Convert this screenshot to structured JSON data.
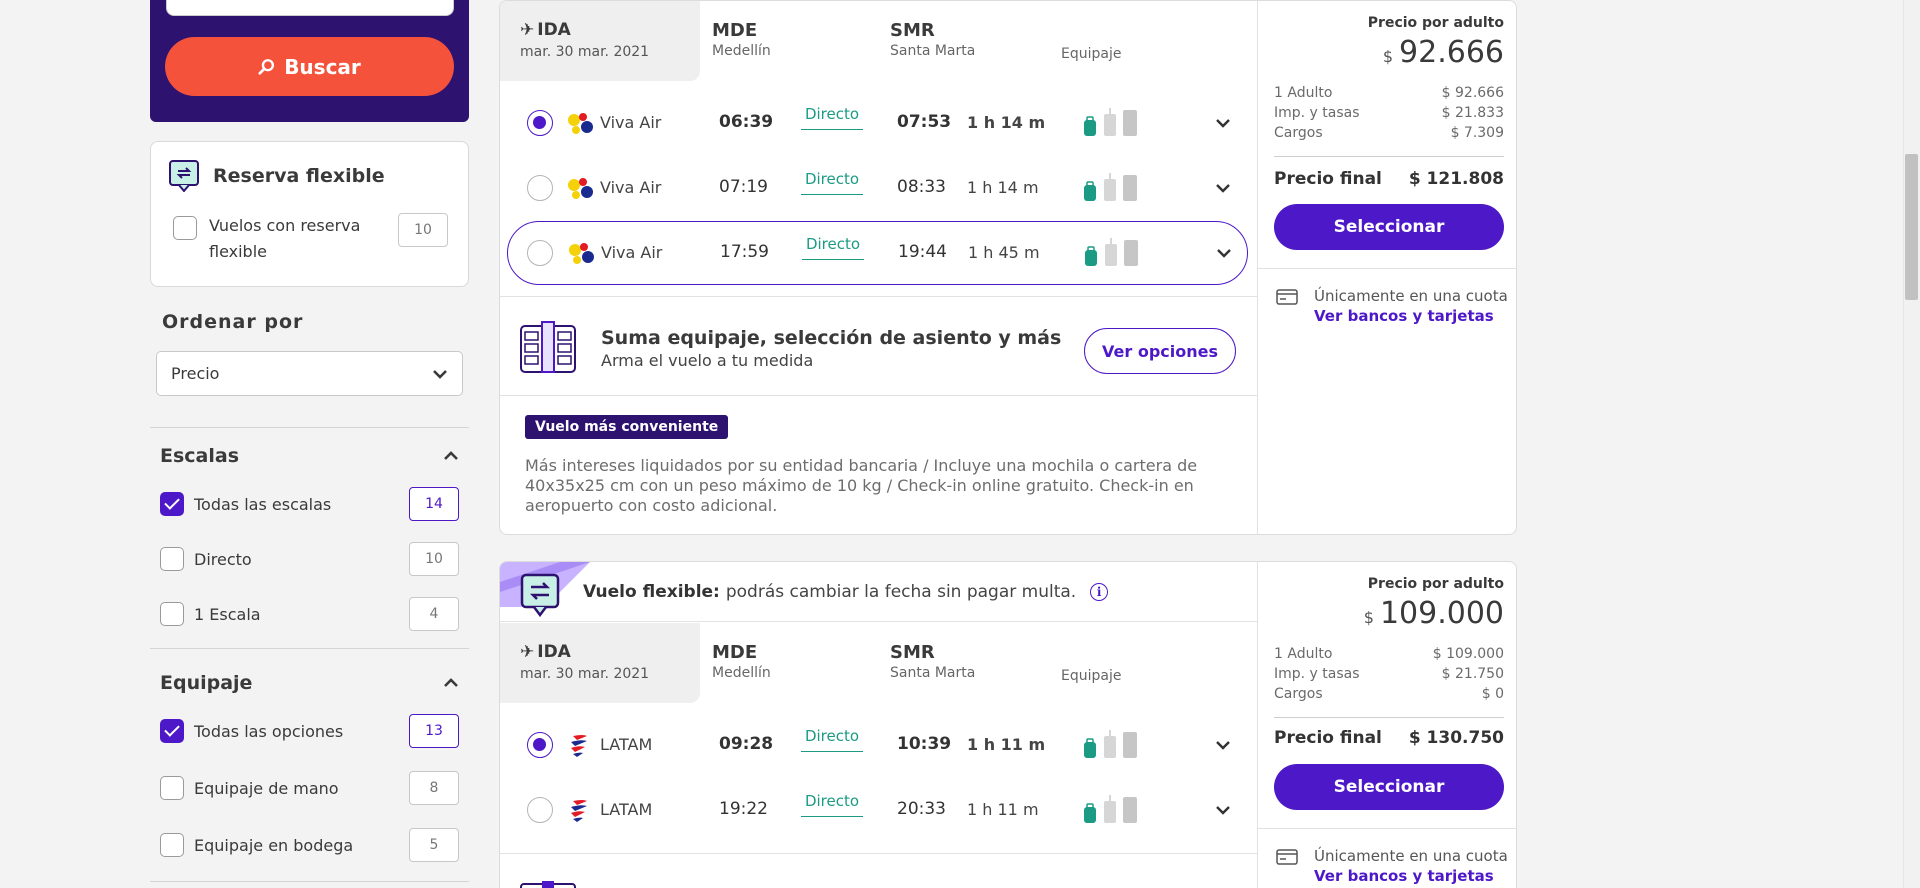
{
  "search": {
    "button_label": "Buscar"
  },
  "flexible_filter": {
    "title": "Reserva flexible",
    "option_label": "Vuelos con reserva flexible",
    "count": "10"
  },
  "sort": {
    "title": "Ordenar por",
    "selected": "Precio"
  },
  "filters": {
    "stops": {
      "title": "Escalas",
      "options": [
        {
          "label": "Todas las escalas",
          "count": "14",
          "checked": true
        },
        {
          "label": "Directo",
          "count": "10",
          "checked": false
        },
        {
          "label": "1 Escala",
          "count": "4",
          "checked": false
        }
      ]
    },
    "baggage": {
      "title": "Equipaje",
      "options": [
        {
          "label": "Todas las opciones",
          "count": "13",
          "checked": true
        },
        {
          "label": "Equipaje de mano",
          "count": "8",
          "checked": false
        },
        {
          "label": "Equipaje en bodega",
          "count": "5",
          "checked": false
        }
      ]
    }
  },
  "card1": {
    "direction": "IDA",
    "date": "mar. 30 mar. 2021",
    "origin": {
      "code": "MDE",
      "city": "Medellín"
    },
    "destination": {
      "code": "SMR",
      "city": "Santa Marta"
    },
    "baggage_header": "Equipaje",
    "flights": [
      {
        "airline": "Viva Air",
        "dep": "06:39",
        "type": "Directo",
        "arr": "07:53",
        "duration": "1 h 14 m"
      },
      {
        "airline": "Viva Air",
        "dep": "07:19",
        "type": "Directo",
        "arr": "08:33",
        "duration": "1 h 14 m"
      },
      {
        "airline": "Viva Air",
        "dep": "17:59",
        "type": "Directo",
        "arr": "19:44",
        "duration": "1 h 45 m"
      }
    ],
    "extras": {
      "title": "Suma equipaje, selección de asiento y más",
      "subtitle": "Arma el vuelo a tu medida",
      "button": "Ver opciones"
    },
    "badge": "Vuelo más conveniente",
    "description": "Más intereses liquidados por su entidad bancaria / Incluye una mochila o cartera de 40x35x25 cm con un peso máximo de 10 kg / Check-in online gratuito. Check-in en aeropuerto con costo adicional.",
    "price": {
      "label": "Precio por adulto",
      "currency": "$",
      "amount": "92.666",
      "rows": [
        {
          "label": "1 Adulto",
          "value": "$ 92.666"
        },
        {
          "label": "Imp. y tasas",
          "value": "$ 21.833"
        },
        {
          "label": "Cargos",
          "value": "$ 7.309"
        }
      ],
      "final_label": "Precio final",
      "final_value": "$ 121.808",
      "select": "Seleccionar",
      "installment": "Únicamente en una cuota",
      "banks_link": "Ver bancos y tarjetas"
    }
  },
  "card2": {
    "flex_title": "Vuelo flexible:",
    "flex_text": "podrás cambiar la fecha sin pagar multa.",
    "info_glyph": "i",
    "direction": "IDA",
    "date": "mar. 30 mar. 2021",
    "origin": {
      "code": "MDE",
      "city": "Medellín"
    },
    "destination": {
      "code": "SMR",
      "city": "Santa Marta"
    },
    "baggage_header": "Equipaje",
    "flights": [
      {
        "airline": "LATAM",
        "dep": "09:28",
        "type": "Directo",
        "arr": "10:39",
        "duration": "1 h 11 m"
      },
      {
        "airline": "LATAM",
        "dep": "19:22",
        "type": "Directo",
        "arr": "20:33",
        "duration": "1 h 11 m"
      }
    ],
    "price": {
      "label": "Precio por adulto",
      "currency": "$",
      "amount": "109.000",
      "rows": [
        {
          "label": "1 Adulto",
          "value": "$ 109.000"
        },
        {
          "label": "Imp. y tasas",
          "value": "$ 21.750"
        },
        {
          "label": "Cargos",
          "value": "$ 0"
        }
      ],
      "final_label": "Precio final",
      "final_value": "$ 130.750",
      "select": "Seleccionar",
      "installment": "Únicamente en una cuota",
      "banks_link": "Ver bancos y tarjetas"
    }
  },
  "colors": {
    "primary": "#4d18c8",
    "dark": "#2d1270",
    "accent": "#f4523b",
    "direct": "#1c9b84"
  }
}
